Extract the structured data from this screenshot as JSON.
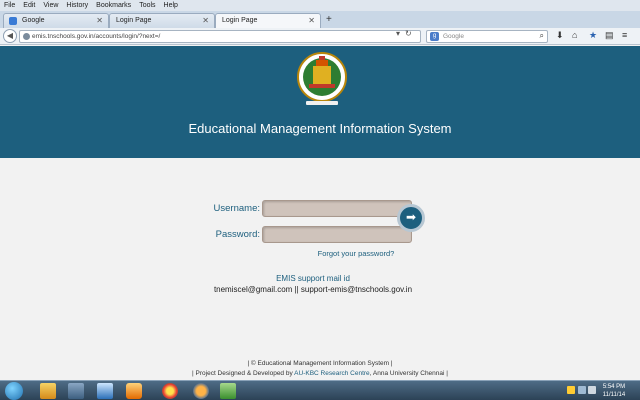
{
  "browser": {
    "menu": [
      "File",
      "Edit",
      "View",
      "History",
      "Bookmarks",
      "Tools",
      "Help"
    ],
    "tabs": [
      {
        "label": "Google"
      },
      {
        "label": "Login Page"
      },
      {
        "label": "Login Page"
      }
    ],
    "new_tab": "+",
    "url": "emis.tnschools.gov.in/accounts/login/?next=/",
    "search_placeholder": "Google"
  },
  "page": {
    "title": "Educational Management Information System",
    "emblem_alt": "Tamil Nadu Government emblem",
    "username_label": "Username:",
    "password_label": "Password:",
    "username_value": "",
    "password_value": "",
    "forgot_link": "Forgot your password?",
    "support_title": "EMIS support mail id",
    "support_emails": "tnemiscel@gmail.com || support-emis@tnschools.gov.in",
    "footer_line1": "| © Educational Management Information System |",
    "footer_line2_prefix": "| Project Designed & Developed by ",
    "footer_line2_link": "AU-KBC Research Centre",
    "footer_line2_suffix": ", Anna University Chennai |"
  },
  "taskbar": {
    "time": "5:54 PM",
    "date": "11/11/14"
  },
  "colors": {
    "header_bg": "#1d5f7e",
    "field_bg": "#cfc3bb",
    "link": "#1d5f7e"
  }
}
